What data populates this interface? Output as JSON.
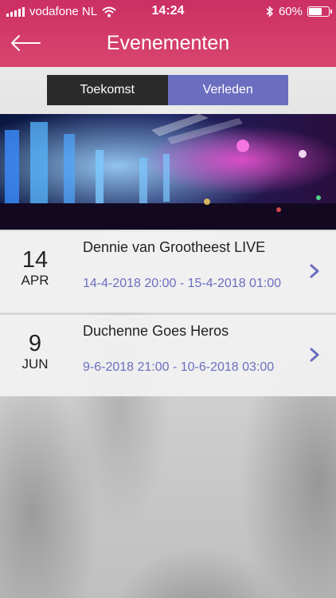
{
  "status": {
    "carrier": "vodafone NL",
    "time": "14:24",
    "battery_text": "60%",
    "battery_level": 0.6
  },
  "header": {
    "title": "Evenementen"
  },
  "tabs": [
    {
      "label": "Toekomst"
    },
    {
      "label": "Verleden"
    }
  ],
  "events": [
    {
      "day": "14",
      "month": "APR",
      "title": "Dennie van Grootheest LIVE",
      "time": "14-4-2018 20:00 - 15-4-2018 01:00"
    },
    {
      "day": "9",
      "month": "JUN",
      "title": "Duchenne Goes Heros",
      "time": "9-6-2018 21:00 - 10-6-2018 03:00"
    }
  ],
  "colors": {
    "header": "#cc2f63",
    "tab_active": "#2b2b2b",
    "tab_inactive": "#6b6ec0",
    "accent": "#6b6ec0"
  },
  "icons": {
    "back": "arrow-left-icon",
    "chevron": "chevron-right-icon",
    "wifi": "wifi-icon",
    "bluetooth": "bluetooth-icon"
  }
}
